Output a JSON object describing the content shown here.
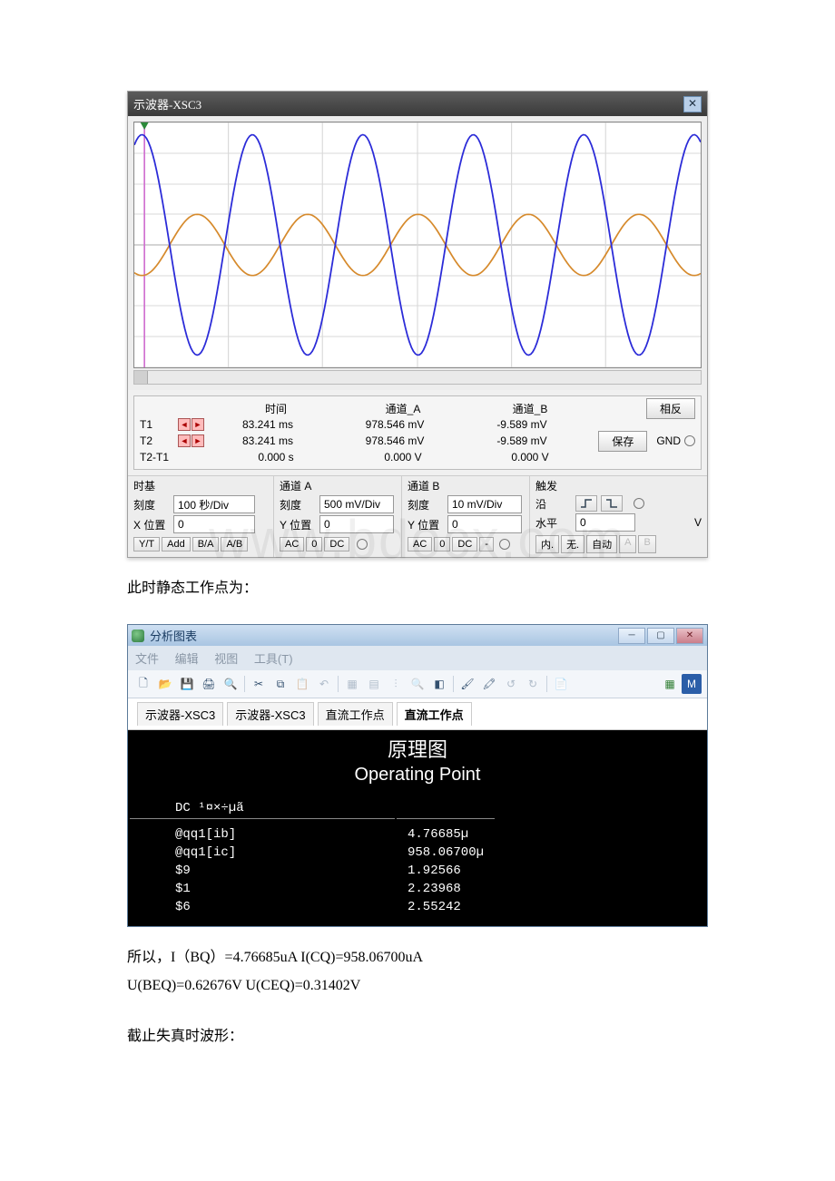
{
  "watermark": "www.bdocx.com",
  "oscilloscope": {
    "title": "示波器-XSC3",
    "cursor_table": {
      "headers": {
        "time": "时间",
        "chA": "通道_A",
        "chB": "通道_B"
      },
      "rows": [
        {
          "name": "T1",
          "time": "83.241 ms",
          "a": "978.546 mV",
          "b": "-9.589 mV"
        },
        {
          "name": "T2",
          "time": "83.241 ms",
          "a": "978.546 mV",
          "b": "-9.589 mV"
        },
        {
          "name": "T2-T1",
          "time": "0.000 s",
          "a": "0.000 V",
          "b": "0.000 V"
        }
      ],
      "buttons": {
        "reverse": "相反",
        "save": "保存",
        "gnd": "GND"
      }
    },
    "timebase": {
      "title": "时基",
      "scale_label": "刻度",
      "scale_value": "100 秒/Div",
      "xpos_label": "X 位置",
      "xpos_value": "0",
      "modes": [
        "Y/T",
        "Add",
        "B/A",
        "A/B"
      ]
    },
    "chA": {
      "title": "通道 A",
      "scale_label": "刻度",
      "scale_value": "500 mV/Div",
      "ypos_label": "Y 位置",
      "ypos_value": "0",
      "modes": [
        "AC",
        "0",
        "DC"
      ]
    },
    "chB": {
      "title": "通道 B",
      "scale_label": "刻度",
      "scale_value": "10 mV/Div",
      "ypos_label": "Y 位置",
      "ypos_value": "0",
      "modes": [
        "AC",
        "0",
        "DC",
        "-"
      ]
    },
    "trigger": {
      "title": "触发",
      "edge_label": "沿",
      "level_label": "水平",
      "level_value": "0",
      "level_unit": "V",
      "modes": [
        "内.",
        "无.",
        "自动"
      ],
      "srcA": "A",
      "srcB": "B"
    }
  },
  "chart_data": {
    "type": "line",
    "title": "",
    "xlabel": "",
    "ylabel": "",
    "x_divisions": 6,
    "y_divisions": 8,
    "series": [
      {
        "name": "通道_A",
        "color": "#d68a2c",
        "amplitude_div": 1.0,
        "period_div": 1.17,
        "phase_deg": 245,
        "scale": "500 mV/Div"
      },
      {
        "name": "通道_B",
        "color": "#2b2bd8",
        "amplitude_div": 3.6,
        "period_div": 1.17,
        "phase_deg": 65,
        "scale": "10 mV/Div"
      }
    ]
  },
  "doc": {
    "line1": "此时静态工作点为：",
    "line2": "所以，I（BQ）=4.76685uA I(CQ)=958.06700uA",
    "line3": " U(BEQ)=0.62676V U(CEQ)=0.31402V",
    "line4": "截止失真时波形："
  },
  "grapher": {
    "title": "分析图表",
    "menus": [
      "文件",
      "编辑",
      "视图",
      "工具(T)"
    ],
    "tabs": [
      "示波器-XSC3",
      "示波器-XSC3",
      "直流工作点",
      "直流工作点"
    ],
    "report": {
      "schem_title": "原理图",
      "op_title": "Operating Point",
      "header": "DC ¹¤×÷µã",
      "rows": [
        {
          "name": "@qq1[ib]",
          "val": "4.76685µ"
        },
        {
          "name": "@qq1[ic]",
          "val": "958.06700µ"
        },
        {
          "name": "$9",
          "val": "1.92566"
        },
        {
          "name": "$1",
          "val": "2.23968"
        },
        {
          "name": "$6",
          "val": "2.55242"
        }
      ]
    }
  }
}
